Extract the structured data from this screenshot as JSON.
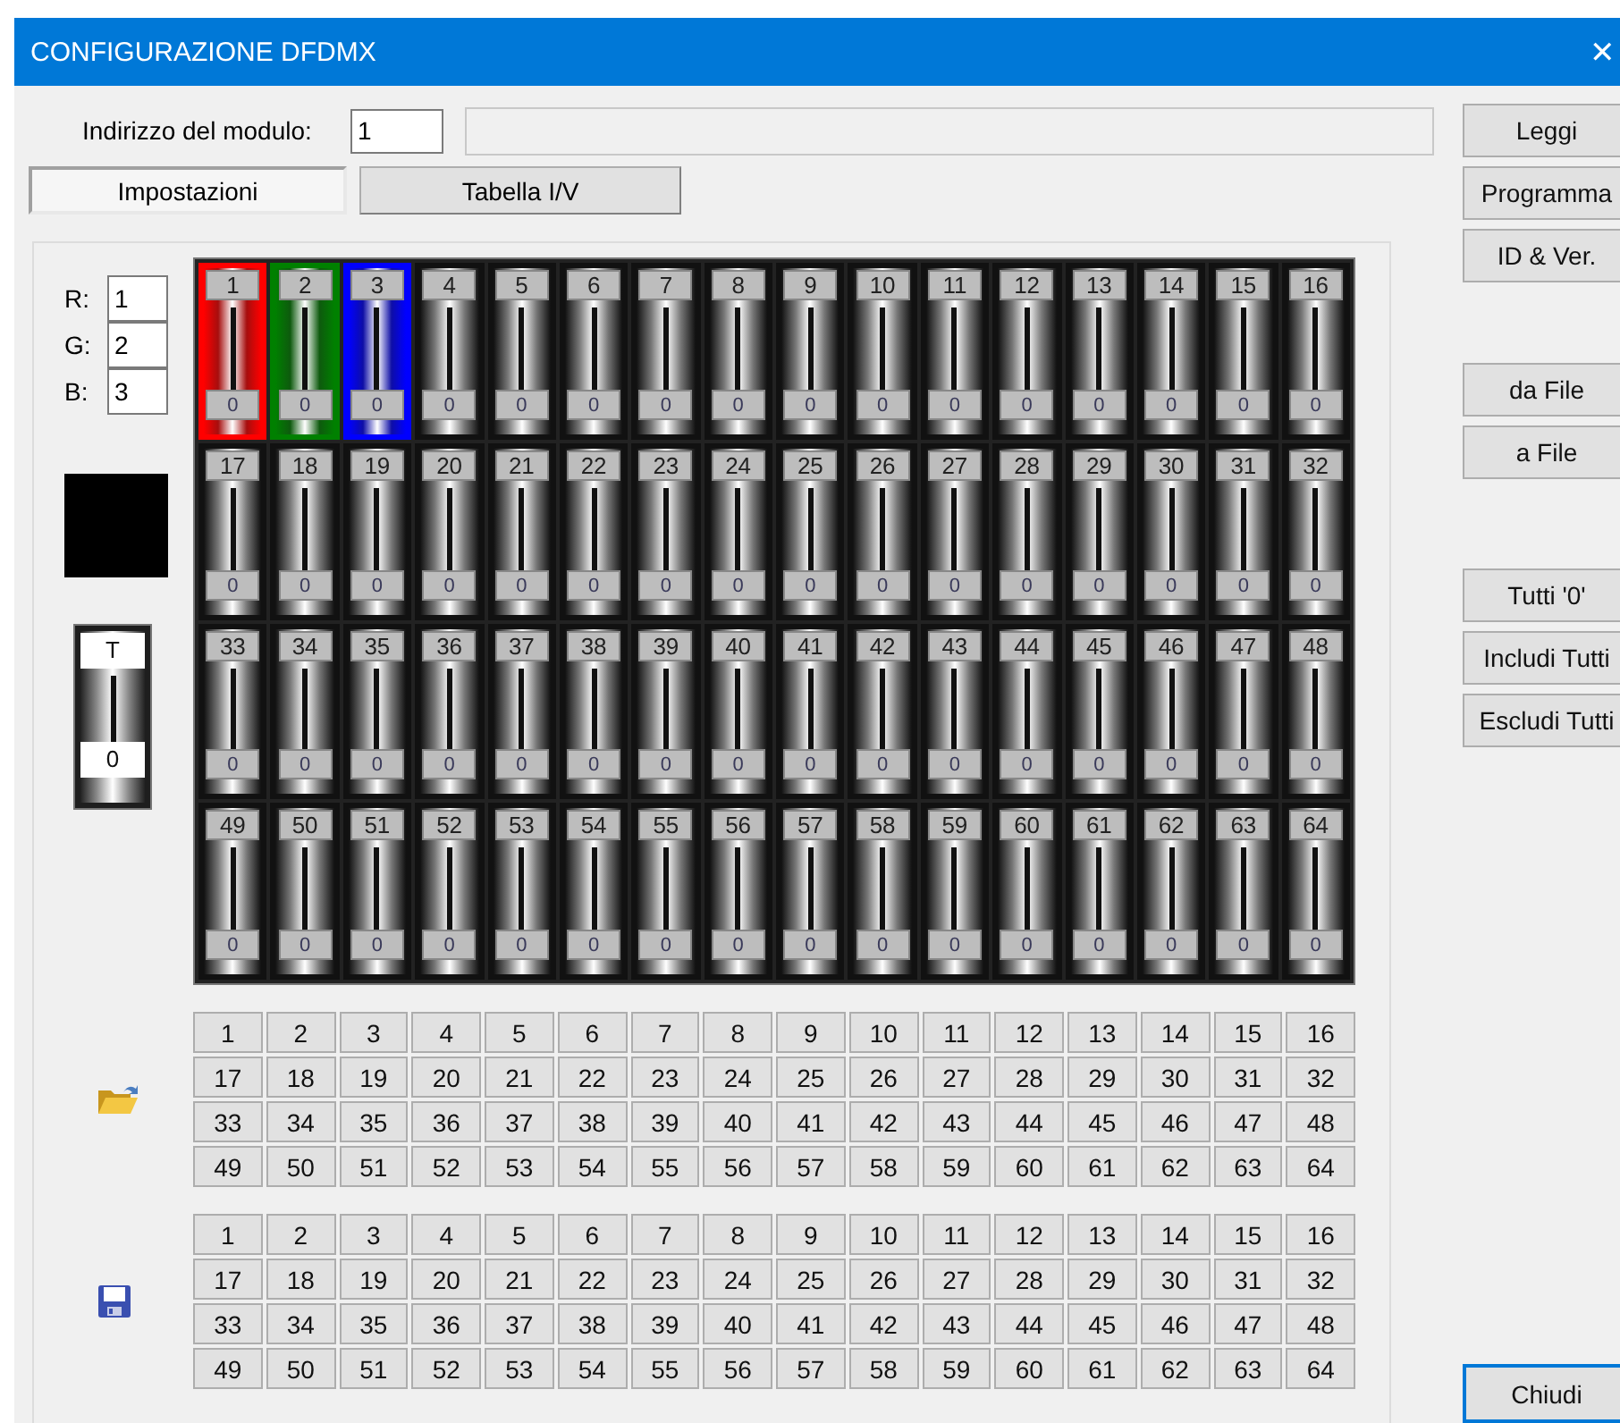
{
  "window": {
    "title": "CONFIGURAZIONE DFDMX",
    "close": "✕"
  },
  "module_address": {
    "label": "Indirizzo del modulo:",
    "value": "1"
  },
  "tabs": [
    {
      "label": "Impostazioni",
      "selected": true
    },
    {
      "label": "Tabella I/V",
      "selected": false
    }
  ],
  "action_groups": [
    [
      "Leggi",
      "Programma",
      "ID & Ver."
    ],
    [
      "da File",
      "a File"
    ],
    [
      "Tutti '0'",
      "Includi Tutti",
      "Escludi Tutti"
    ]
  ],
  "close_button": {
    "label": "Chiudi",
    "default": true
  },
  "rgb_fields": [
    {
      "label": "R:",
      "value": "1"
    },
    {
      "label": "G:",
      "value": "2"
    },
    {
      "label": "B:",
      "value": "3"
    }
  ],
  "swatch": {
    "color": "#000000"
  },
  "master_fader": {
    "label": "T",
    "value": "0"
  },
  "channels": [
    {
      "number": "1",
      "value": "0",
      "color": "#ff0000"
    },
    {
      "number": "2",
      "value": "0",
      "color": "#008000"
    },
    {
      "number": "3",
      "value": "0",
      "color": "#0000ff"
    },
    {
      "number": "4",
      "value": "0"
    },
    {
      "number": "5",
      "value": "0"
    },
    {
      "number": "6",
      "value": "0"
    },
    {
      "number": "7",
      "value": "0"
    },
    {
      "number": "8",
      "value": "0"
    },
    {
      "number": "9",
      "value": "0"
    },
    {
      "number": "10",
      "value": "0"
    },
    {
      "number": "11",
      "value": "0"
    },
    {
      "number": "12",
      "value": "0"
    },
    {
      "number": "13",
      "value": "0"
    },
    {
      "number": "14",
      "value": "0"
    },
    {
      "number": "15",
      "value": "0"
    },
    {
      "number": "16",
      "value": "0"
    },
    {
      "number": "17",
      "value": "0"
    },
    {
      "number": "18",
      "value": "0"
    },
    {
      "number": "19",
      "value": "0"
    },
    {
      "number": "20",
      "value": "0"
    },
    {
      "number": "21",
      "value": "0"
    },
    {
      "number": "22",
      "value": "0"
    },
    {
      "number": "23",
      "value": "0"
    },
    {
      "number": "24",
      "value": "0"
    },
    {
      "number": "25",
      "value": "0"
    },
    {
      "number": "26",
      "value": "0"
    },
    {
      "number": "27",
      "value": "0"
    },
    {
      "number": "28",
      "value": "0"
    },
    {
      "number": "29",
      "value": "0"
    },
    {
      "number": "30",
      "value": "0"
    },
    {
      "number": "31",
      "value": "0"
    },
    {
      "number": "32",
      "value": "0"
    },
    {
      "number": "33",
      "value": "0"
    },
    {
      "number": "34",
      "value": "0"
    },
    {
      "number": "35",
      "value": "0"
    },
    {
      "number": "36",
      "value": "0"
    },
    {
      "number": "37",
      "value": "0"
    },
    {
      "number": "38",
      "value": "0"
    },
    {
      "number": "39",
      "value": "0"
    },
    {
      "number": "40",
      "value": "0"
    },
    {
      "number": "41",
      "value": "0"
    },
    {
      "number": "42",
      "value": "0"
    },
    {
      "number": "43",
      "value": "0"
    },
    {
      "number": "44",
      "value": "0"
    },
    {
      "number": "45",
      "value": "0"
    },
    {
      "number": "46",
      "value": "0"
    },
    {
      "number": "47",
      "value": "0"
    },
    {
      "number": "48",
      "value": "0"
    },
    {
      "number": "49",
      "value": "0"
    },
    {
      "number": "50",
      "value": "0"
    },
    {
      "number": "51",
      "value": "0"
    },
    {
      "number": "52",
      "value": "0"
    },
    {
      "number": "53",
      "value": "0"
    },
    {
      "number": "54",
      "value": "0"
    },
    {
      "number": "55",
      "value": "0"
    },
    {
      "number": "56",
      "value": "0"
    },
    {
      "number": "57",
      "value": "0"
    },
    {
      "number": "58",
      "value": "0"
    },
    {
      "number": "59",
      "value": "0"
    },
    {
      "number": "60",
      "value": "0"
    },
    {
      "number": "61",
      "value": "0"
    },
    {
      "number": "62",
      "value": "0"
    },
    {
      "number": "63",
      "value": "0"
    },
    {
      "number": "64",
      "value": "0"
    }
  ],
  "load_grid": [
    "1",
    "2",
    "3",
    "4",
    "5",
    "6",
    "7",
    "8",
    "9",
    "10",
    "11",
    "12",
    "13",
    "14",
    "15",
    "16",
    "17",
    "18",
    "19",
    "20",
    "21",
    "22",
    "23",
    "24",
    "25",
    "26",
    "27",
    "28",
    "29",
    "30",
    "31",
    "32",
    "33",
    "34",
    "35",
    "36",
    "37",
    "38",
    "39",
    "40",
    "41",
    "42",
    "43",
    "44",
    "45",
    "46",
    "47",
    "48",
    "49",
    "50",
    "51",
    "52",
    "53",
    "54",
    "55",
    "56",
    "57",
    "58",
    "59",
    "60",
    "61",
    "62",
    "63",
    "64"
  ],
  "save_grid": [
    "1",
    "2",
    "3",
    "4",
    "5",
    "6",
    "7",
    "8",
    "9",
    "10",
    "11",
    "12",
    "13",
    "14",
    "15",
    "16",
    "17",
    "18",
    "19",
    "20",
    "21",
    "22",
    "23",
    "24",
    "25",
    "26",
    "27",
    "28",
    "29",
    "30",
    "31",
    "32",
    "33",
    "34",
    "35",
    "36",
    "37",
    "38",
    "39",
    "40",
    "41",
    "42",
    "43",
    "44",
    "45",
    "46",
    "47",
    "48",
    "49",
    "50",
    "51",
    "52",
    "53",
    "54",
    "55",
    "56",
    "57",
    "58",
    "59",
    "60",
    "61",
    "62",
    "63",
    "64"
  ]
}
